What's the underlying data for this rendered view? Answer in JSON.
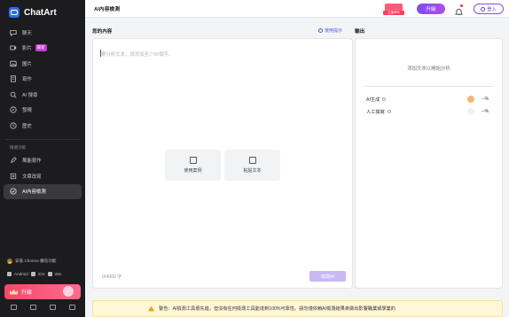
{
  "app": {
    "brand": "ChatArt"
  },
  "sidebar": {
    "items": [
      {
        "label": "聊天",
        "icon": "chat-icon"
      },
      {
        "label": "影片",
        "icon": "video-icon",
        "badge": "最新"
      },
      {
        "label": "圖片",
        "icon": "image-icon"
      },
      {
        "label": "寫作",
        "icon": "document-icon"
      },
      {
        "label": "AI 搜尋",
        "icon": "search-icon"
      },
      {
        "label": "發現",
        "icon": "compass-icon"
      },
      {
        "label": "歷史",
        "icon": "history-icon"
      }
    ],
    "section_label": "精選功能",
    "featured": [
      {
        "label": "萬能寫作",
        "icon": "pen-icon"
      },
      {
        "label": "文章改寫",
        "icon": "rewrite-icon"
      },
      {
        "label": "AI內容檢測",
        "icon": "ai-detect-icon",
        "active": true
      }
    ],
    "chrome_text": "安裝 Chrome 擴充功能",
    "platforms": [
      "Android",
      "iOS",
      "Win"
    ],
    "upgrade_label": "升級"
  },
  "topbar": {
    "title": "AI內容檢測",
    "promo_tag": "立省86%",
    "upgrade_label": "升級",
    "login_label": "登入"
  },
  "input": {
    "section_label": "您的內容",
    "usage_tip": "使用提示",
    "placeholder": "要分析文本，請添加至少50個字。",
    "sample_label": "使用案例",
    "paste_label": "粘貼文本",
    "char_count": "0/4000 字",
    "detect_label": "檢測AI"
  },
  "output": {
    "section_label": "輸出",
    "hint": "添加文本以開始分析",
    "rows": [
      {
        "label": "AI生成",
        "value": "--%",
        "color": "#f5b37a"
      },
      {
        "label": "人工撰寫",
        "value": "--%",
        "color": "#f1f1f1"
      }
    ]
  },
  "warning": {
    "text": "警告：AI檢測工具很先進，但沒有任何檢測工具能達到100%可靠性。請勿僅依賴AI檢測結果來做出影響職業或學業的"
  }
}
